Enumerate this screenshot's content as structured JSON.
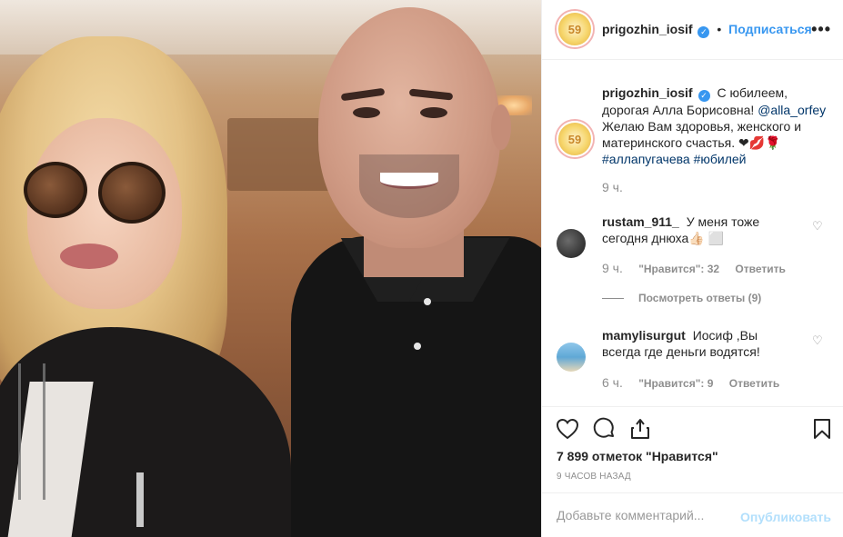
{
  "post": {
    "author": "prigozhin_iosif",
    "avatar_text": "59",
    "follow_label": "Подписаться",
    "more_icon": "more-horizontal-icon"
  },
  "caption": {
    "author": "prigozhin_iosif",
    "text_1": "С юбилеем, дорогая Алла Борисовна!",
    "mention": "@alla_orfey",
    "text_2": "Желаю Вам здоровья, женского и материнского счастья.",
    "emoji": "❤💋🌹",
    "tag_1": "#аллапугачева",
    "tag_2": "#юбилей",
    "time": "9 ч."
  },
  "comments": [
    {
      "author": "rustam_911_",
      "text": "У меня тоже сегодня днюха👍🏻 ⬜",
      "time": "9 ч.",
      "likes": "\"Нравится\": 32",
      "reply": "Ответить",
      "view_replies": "Посмотреть ответы (9)"
    },
    {
      "author": "mamylisurgut",
      "text": "Иосиф ,Вы всегда где деньги водятся!",
      "time": "6 ч.",
      "likes": "\"Нравится\": 9",
      "reply": "Ответить"
    }
  ],
  "likes_count": "7 899 отметок \"Нравится\"",
  "posted_ago": "9 часов назад",
  "add_comment": {
    "placeholder": "Добавьте комментарий...",
    "publish_label": "Опубликовать"
  },
  "colors": {
    "link_blue": "#3897f0",
    "mention": "#003569",
    "secondary": "#8e8e8e",
    "publish_disabled": "#b2dffc"
  }
}
